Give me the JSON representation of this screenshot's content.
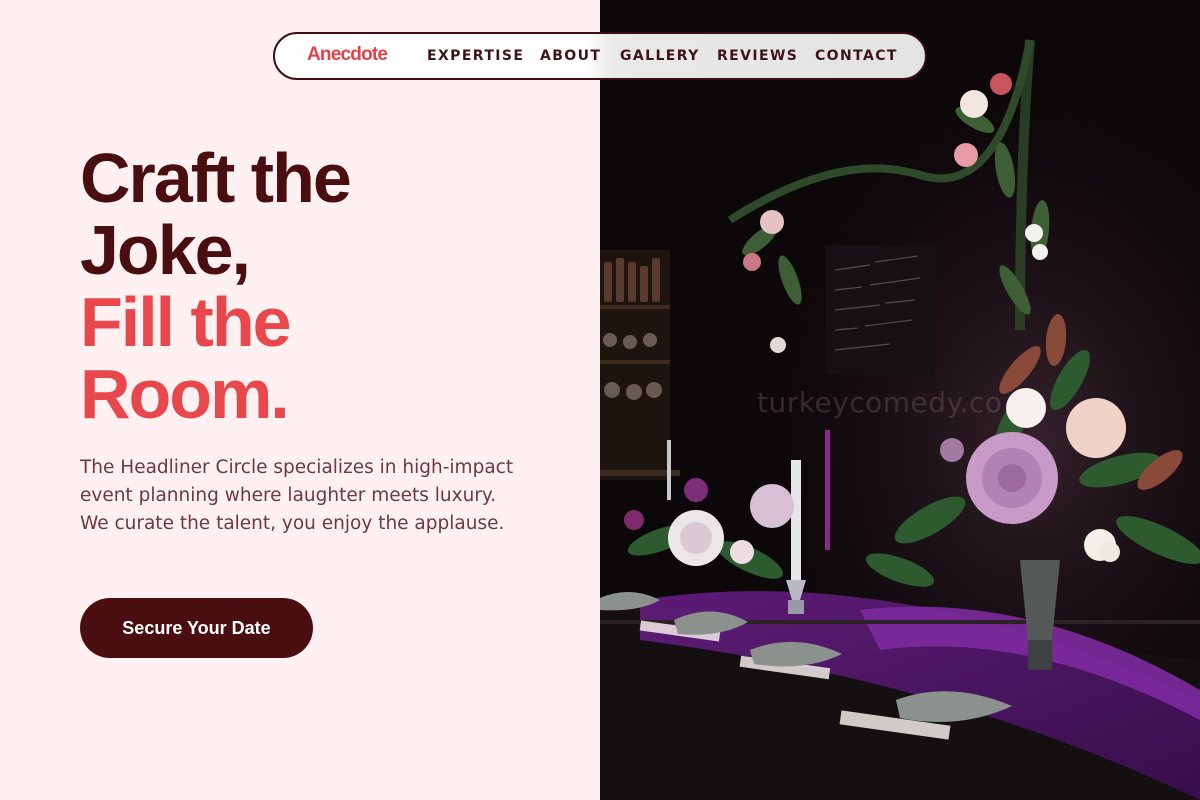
{
  "brand": {
    "logo_text": "Anecdote",
    "logo_color": "#e0444a"
  },
  "nav": {
    "links": [
      "EXPERTISE",
      "ABOUT",
      "GALLERY",
      "REVIEWS",
      "CONTACT"
    ]
  },
  "hero": {
    "headline_line1": "Craft the",
    "headline_line2": "Joke,",
    "headline_line3": "Fill the",
    "headline_line4": "Room.",
    "description": "The Headliner Circle specializes in high-impact event planning where laughter meets luxury. We curate the talent, you enjoy the applause.",
    "cta_label": "Secure Your Date"
  },
  "image": {
    "watermark": "turkeycomedy.co",
    "subject": "dark banquet table with floral centerpieces, candles and purple linens"
  },
  "colors": {
    "background": "#fff1f1",
    "dark": "#4a0e10",
    "accent": "#e8474c",
    "body_text": "#6b3a3d"
  }
}
